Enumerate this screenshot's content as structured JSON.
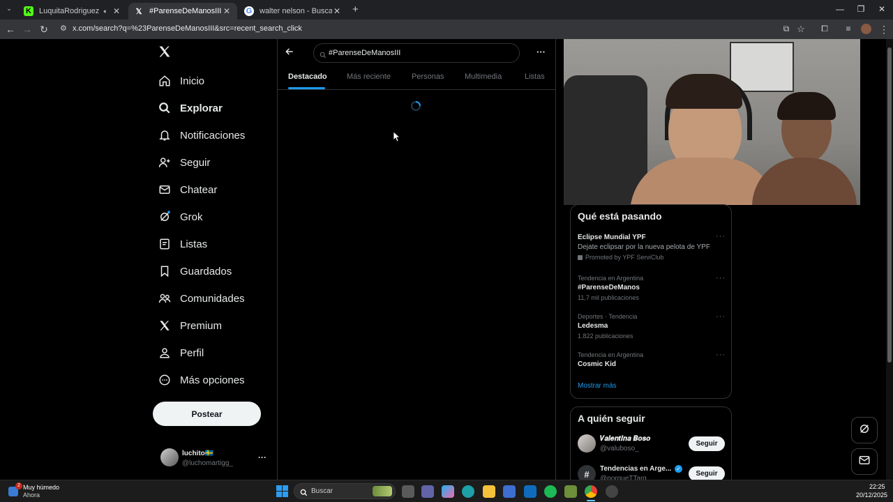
{
  "browser": {
    "tabs": [
      {
        "title": "LuquitaRodriguez Stream -",
        "active": false,
        "favicon": "kick-icon",
        "muted_icon": "speaker-icon"
      },
      {
        "title": "#ParenseDeManosIII - Buscar /",
        "active": true,
        "favicon": "x-logo-icon"
      },
      {
        "title": "walter nelson - Buscar con Goo",
        "active": false,
        "favicon": "google-icon"
      }
    ],
    "new_tab": "+",
    "url": "x.com/search?q=%23ParenseDeManosIII&src=recent_search_click"
  },
  "sidebar": {
    "items": [
      {
        "label": "Inicio",
        "icon": "home-icon"
      },
      {
        "label": "Explorar",
        "icon": "search-icon",
        "active": true
      },
      {
        "label": "Notificaciones",
        "icon": "bell-icon"
      },
      {
        "label": "Seguir",
        "icon": "person-plus-icon"
      },
      {
        "label": "Chatear",
        "icon": "mail-icon"
      },
      {
        "label": "Grok",
        "icon": "grok-icon"
      },
      {
        "label": "Listas",
        "icon": "list-icon"
      },
      {
        "label": "Guardados",
        "icon": "bookmark-icon"
      },
      {
        "label": "Comunidades",
        "icon": "people-icon"
      },
      {
        "label": "Premium",
        "icon": "x-logo-icon"
      },
      {
        "label": "Perfil",
        "icon": "person-icon"
      },
      {
        "label": "Más opciones",
        "icon": "more-circle-icon"
      }
    ],
    "post_button": "Postear",
    "account": {
      "name": "luchito🇸🇪",
      "handle": "@luchomartigg_",
      "more": "···"
    }
  },
  "search": {
    "query": "#ParenseDeManosIII",
    "tabs": [
      "Destacado",
      "Más reciente",
      "Personas",
      "Multimedia",
      "Listas"
    ],
    "active_tab": "Destacado",
    "more": "···"
  },
  "trends": {
    "title": "Qué está pasando",
    "items": [
      {
        "meta": "",
        "name": "Eclipse Mundial YPF",
        "desc": "Dejate eclipsar por la nueva pelota de YPF",
        "sub": "Promoted by YPF ServiClub"
      },
      {
        "meta": "Tendencia en Argentina",
        "name": "#ParenseDeManos",
        "desc": "",
        "sub": "11,7 mil publicaciones"
      },
      {
        "meta": "Deportes · Tendencia",
        "name": "Ledesma",
        "desc": "",
        "sub": "1.822 publicaciones"
      },
      {
        "meta": "Tendencia en Argentina",
        "name": "Cosmic Kid",
        "desc": "",
        "sub": ""
      }
    ],
    "show_more": "Mostrar más"
  },
  "who_to_follow": {
    "title": "A quién seguir",
    "users": [
      {
        "name": "𝑽𝒂𝒍𝒆𝒏𝒕𝒊𝒏𝒂 𝑩𝒐𝒔𝒐",
        "handle": "@valuboso_",
        "button": "Seguir"
      },
      {
        "name": "Tendencias en Arge...",
        "handle": "@porqueTTarg",
        "button": "Seguir"
      }
    ]
  },
  "taskbar": {
    "weather": {
      "badge": "2",
      "line1": "Muy húmedo",
      "line2": "Ahora"
    },
    "search_placeholder": "Buscar",
    "time": "22:25",
    "date": "20/12/2025"
  },
  "colors": {
    "accent": "#1d9bf0",
    "background": "#000000",
    "border": "#2f3336",
    "muted": "#71767b"
  }
}
